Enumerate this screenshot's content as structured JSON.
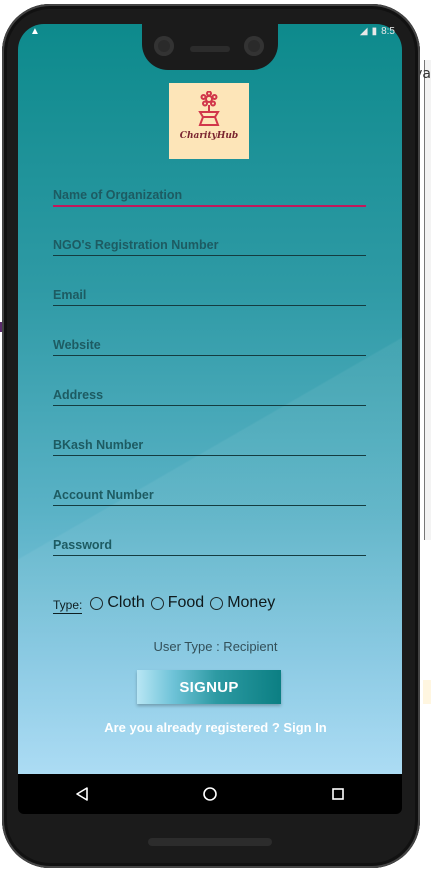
{
  "app": {
    "logo_text": "CharityHub"
  },
  "form": {
    "fields": [
      {
        "id": "org",
        "placeholder": "Name of Organization",
        "value": ""
      },
      {
        "id": "ngo_reg",
        "placeholder": "NGO's Registration Number",
        "value": ""
      },
      {
        "id": "email",
        "placeholder": "Email",
        "value": ""
      },
      {
        "id": "website",
        "placeholder": "Website",
        "value": ""
      },
      {
        "id": "address",
        "placeholder": "Address",
        "value": ""
      },
      {
        "id": "bkash",
        "placeholder": "BKash Number",
        "value": ""
      },
      {
        "id": "account",
        "placeholder": "Account Number",
        "value": ""
      },
      {
        "id": "password",
        "placeholder": "Password",
        "value": ""
      }
    ],
    "type_label": "Type:",
    "type_options": [
      {
        "label": "Cloth",
        "checked": false
      },
      {
        "label": "Food",
        "checked": false
      },
      {
        "label": "Money",
        "checked": false
      }
    ],
    "user_type_text": "User Type : Recipient",
    "signup_label": "SIGNUP",
    "signin_text": "Are you already registered ? Sign In"
  },
  "status_bar": {
    "time": "8:5"
  },
  "background_window": {
    "fragment": "va"
  },
  "colors": {
    "accent_underline": "#c2185b",
    "gradient_top": "#0d8a8c",
    "gradient_bottom": "#a7daf3"
  },
  "icons": {
    "nav_back": "back-triangle-icon",
    "nav_home": "home-circle-icon",
    "nav_recents": "recents-square-icon",
    "logo": "flower-pot-icon"
  }
}
